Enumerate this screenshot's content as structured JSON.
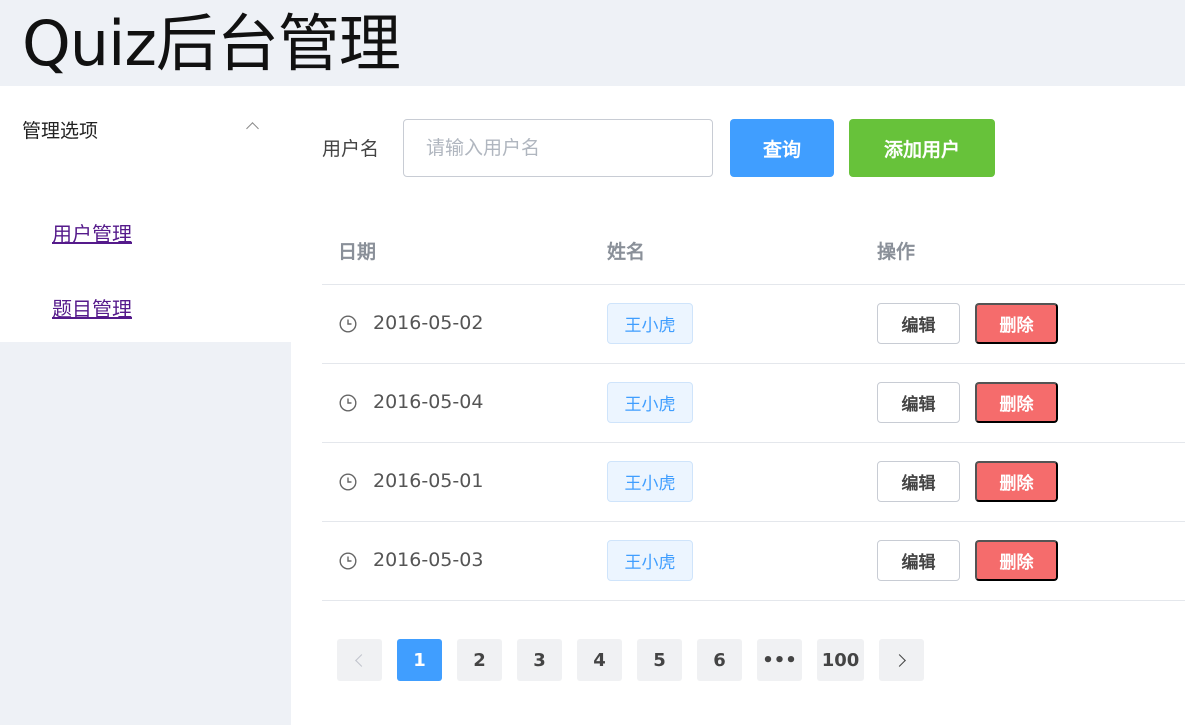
{
  "app": {
    "title": "Quiz后台管理"
  },
  "sidebar": {
    "submenu_title": "管理选项",
    "items": [
      {
        "label": "用户管理"
      },
      {
        "label": "题目管理"
      }
    ]
  },
  "search": {
    "label": "用户名",
    "placeholder": "请输入用户名",
    "value": "",
    "query_label": "查询",
    "add_label": "添加用户"
  },
  "table": {
    "columns": [
      "日期",
      "姓名",
      "操作"
    ],
    "rows": [
      {
        "date": "2016-05-02",
        "name": "王小虎",
        "edit": "编辑",
        "delete": "删除"
      },
      {
        "date": "2016-05-04",
        "name": "王小虎",
        "edit": "编辑",
        "delete": "删除"
      },
      {
        "date": "2016-05-01",
        "name": "王小虎",
        "edit": "编辑",
        "delete": "删除"
      },
      {
        "date": "2016-05-03",
        "name": "王小虎",
        "edit": "编辑",
        "delete": "删除"
      }
    ]
  },
  "pagination": {
    "prev_icon": "chevron-left-icon",
    "next_icon": "chevron-right-icon",
    "current": 1,
    "pages": [
      "1",
      "2",
      "3",
      "4",
      "5",
      "6",
      "•••",
      "100"
    ]
  },
  "colors": {
    "primary": "#409eff",
    "success": "#67c23a",
    "danger": "#f56c6c",
    "background": "#eef1f6"
  }
}
